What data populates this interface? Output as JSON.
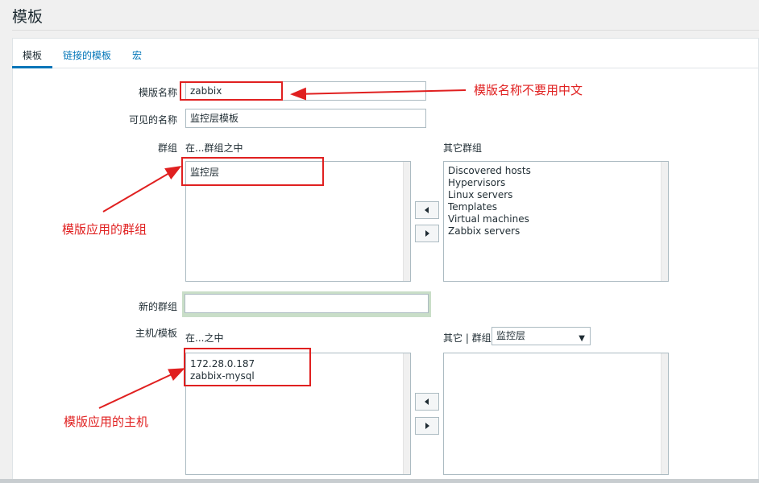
{
  "page": {
    "title": "模板"
  },
  "tabs": [
    {
      "label": "模板"
    },
    {
      "label": "链接的模板"
    },
    {
      "label": "宏"
    }
  ],
  "form": {
    "template_name_label": "模版名称",
    "template_name_value": "zabbix",
    "visible_name_label": "可见的名称",
    "visible_name_value": "监控层模板",
    "groups_label": "群组",
    "in_groups_head": "在...群组之中",
    "other_groups_head": "其它群组",
    "in_groups": [
      "监控层"
    ],
    "other_groups": [
      "Discovered hosts",
      "Hypervisors",
      "Linux servers",
      "Templates",
      "Virtual machines",
      "Zabbix servers"
    ],
    "new_group_label": "新的群组",
    "new_group_value": "",
    "hosts_label": "主机/模板",
    "in_hosts_head": "在...之中",
    "other_hosts_head": "其它 | 群组",
    "other_hosts_group_select": "监控层",
    "in_hosts": [
      "172.28.0.187",
      "zabbix-mysql"
    ],
    "other_hosts": []
  },
  "annotations": {
    "name_note": "模版名称不要用中文",
    "group_note": "模版应用的群组",
    "host_note": "模版应用的主机"
  },
  "colors": {
    "link": "#0275b8",
    "annotation": "#e02020",
    "border": "#acbbc2"
  },
  "icons": {
    "move_left": "triangle-left-icon",
    "move_right": "triangle-right-icon",
    "dropdown": "caret-down-icon"
  }
}
